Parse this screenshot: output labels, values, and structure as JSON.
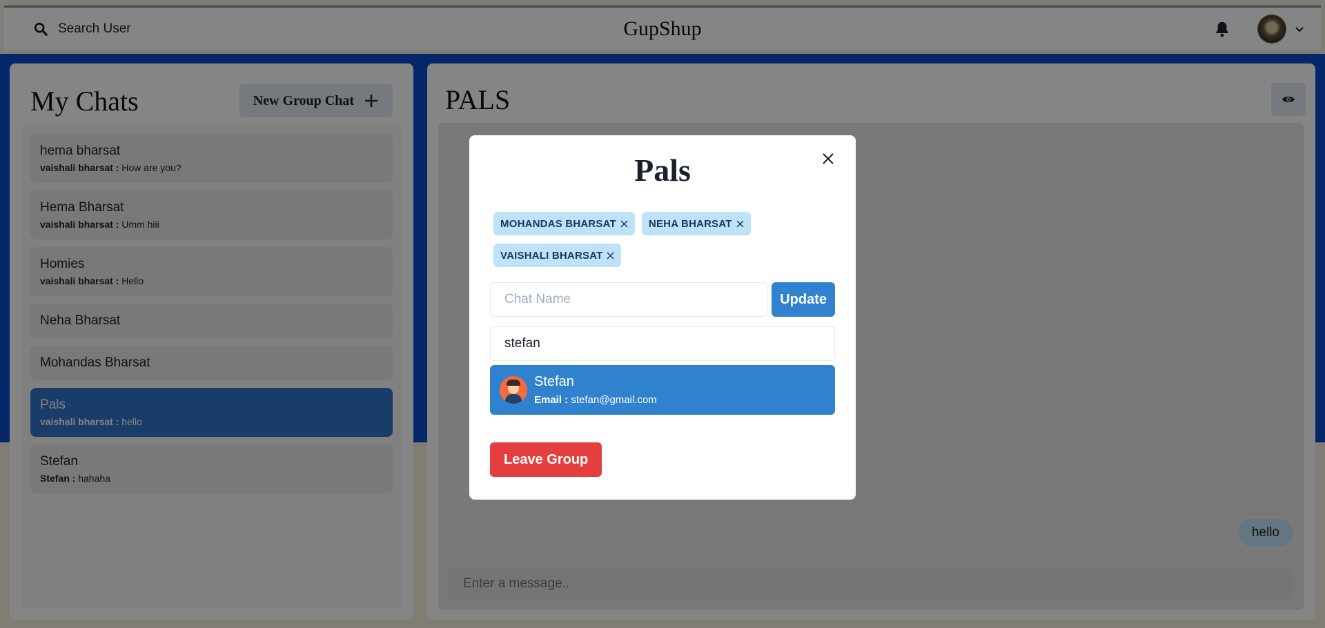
{
  "header": {
    "search_label": "Search User",
    "brand": "GupShup"
  },
  "sidebar": {
    "title": "My Chats",
    "new_group_label": "New Group Chat",
    "chats": [
      {
        "name": "hema bharsat",
        "sender": "vaishali bharsat :",
        "message": "How are you?"
      },
      {
        "name": "Hema Bharsat",
        "sender": "vaishali bharsat :",
        "message": "Umm hiii"
      },
      {
        "name": "Homies",
        "sender": "vaishali bharsat :",
        "message": "Hello"
      },
      {
        "name": "Neha Bharsat"
      },
      {
        "name": "Mohandas Bharsat"
      },
      {
        "name": "Pals",
        "sender": "vaishali bharsat :",
        "message": "hello",
        "selected": true
      },
      {
        "name": "Stefan",
        "sender": "Stefan :",
        "message": "hahaha"
      }
    ]
  },
  "chat": {
    "title": "PALS",
    "last_message": "hello",
    "input_placeholder": "Enter a message.."
  },
  "modal": {
    "title": "Pals",
    "members": [
      "MOHANDAS BHARSAT",
      "NEHA BHARSAT",
      "VAISHALI BHARSAT"
    ],
    "chat_name_placeholder": "Chat Name",
    "update_label": "Update",
    "search_value": "stefan",
    "result": {
      "name": "Stefan",
      "email_label": "Email :",
      "email": "stefan@gmail.com"
    },
    "leave_label": "Leave Group"
  },
  "colors": {
    "accent": "#3182ce",
    "badge": "#bee3f8",
    "danger": "#e53e3e",
    "backdrop_blue": "#0a49c9"
  }
}
